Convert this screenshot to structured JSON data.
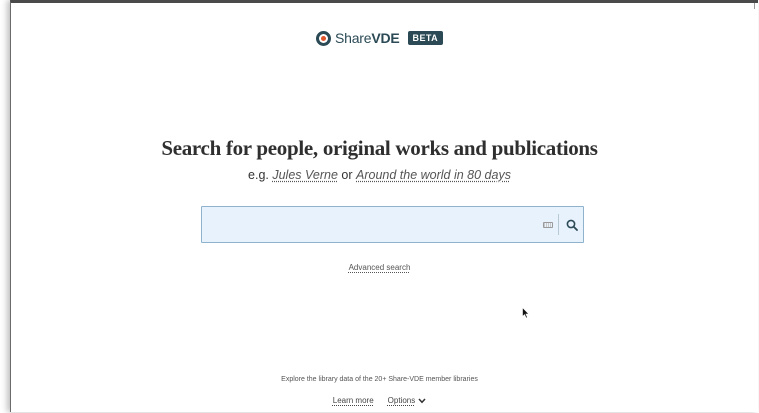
{
  "brand": {
    "name_light": "Share",
    "name_bold": "VDE",
    "badge": "BETA",
    "colors": {
      "primary": "#2b4a55",
      "accent": "#e0552b"
    },
    "icon": "sharevde-logo-icon"
  },
  "hero": {
    "headline": "Search for people, original works and publications",
    "examples_prefix": "e.g.",
    "example_1": "Jules Verne",
    "examples_joiner": "or",
    "example_2": "Around the world in 80 days"
  },
  "search": {
    "value": "",
    "placeholder": "",
    "keyboard_icon": "keyboard-icon",
    "submit_icon": "search-icon",
    "field_color": "#e8f2fd"
  },
  "advanced_search": {
    "label": "Advanced search"
  },
  "footer": {
    "text": "Explore the library data of the 20+ Share-VDE member libraries",
    "learn_more": "Learn more",
    "options": "Options",
    "options_icon": "chevron-down-icon"
  }
}
